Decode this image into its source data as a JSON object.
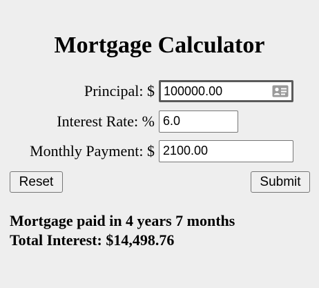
{
  "title": "Mortgage Calculator",
  "form": {
    "principal": {
      "label": "Principal: $",
      "value": "100000.00"
    },
    "interest_rate": {
      "label": "Interest Rate: %",
      "value": "6.0"
    },
    "monthly_payment": {
      "label": "Monthly Payment: $",
      "value": "2100.00"
    }
  },
  "buttons": {
    "reset_label": "Reset",
    "submit_label": "Submit"
  },
  "results": {
    "paid_in": "Mortgage paid in 4 years 7 months",
    "total_interest": "Total Interest: $14,498.76"
  },
  "icons": {
    "autofill": "contact-card-icon"
  }
}
